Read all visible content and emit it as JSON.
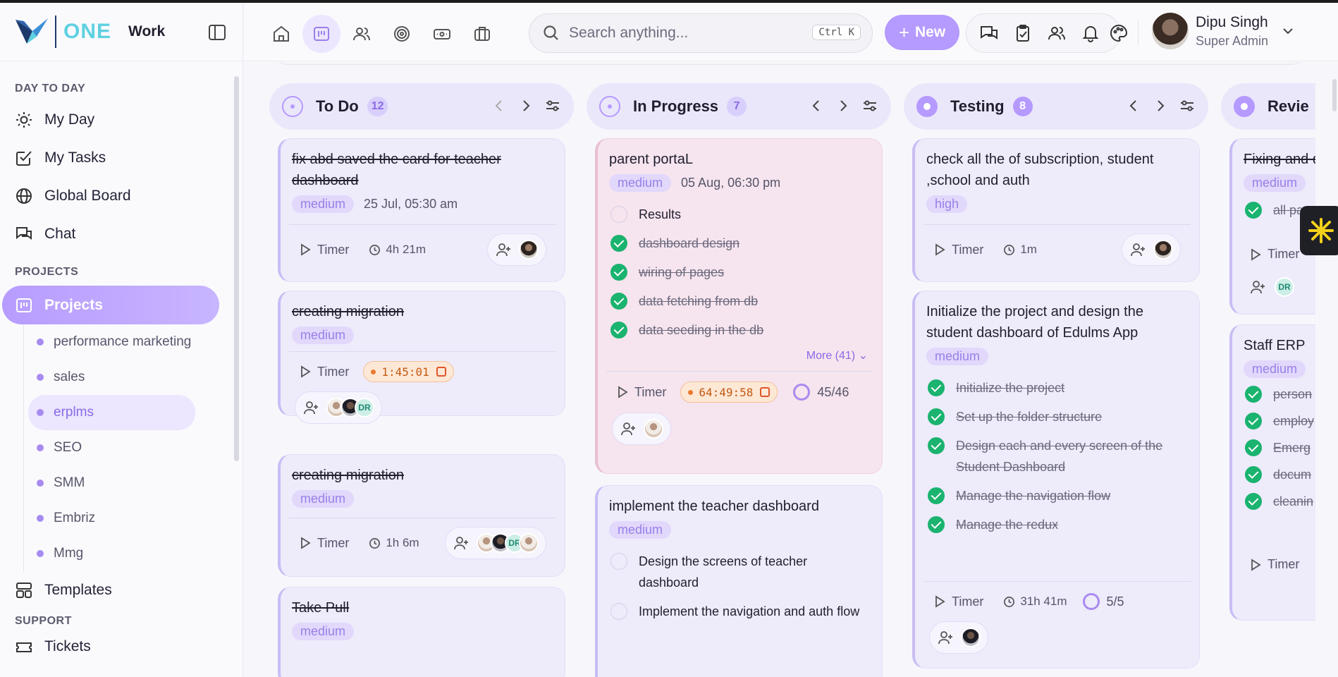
{
  "brand": {
    "one": "ONE",
    "work": "Work"
  },
  "sidebar": {
    "section_day": "DAY TO DAY",
    "day_items": [
      {
        "label": "My Day",
        "icon": "sun-icon"
      },
      {
        "label": "My Tasks",
        "icon": "checkbox-icon"
      },
      {
        "label": "Global Board",
        "icon": "globe-icon"
      },
      {
        "label": "Chat",
        "icon": "chat-icon"
      }
    ],
    "section_projects": "PROJECTS",
    "projects_label": "Projects",
    "sub_items": [
      "performance marketing",
      "sales",
      "erplms",
      "SEO",
      "SMM",
      "Embriz",
      "Mmg"
    ],
    "active_sub": "erplms",
    "templates_label": "Templates",
    "section_support": "SUPPORT",
    "tickets_label": "Tickets"
  },
  "header": {
    "search_placeholder": "Search anything...",
    "search_shortcut": "Ctrl K",
    "new_label": "New",
    "user_name": "Dipu Singh",
    "user_role": "Super Admin"
  },
  "columns": [
    {
      "title": "To Do",
      "count": "12"
    },
    {
      "title": "In Progress",
      "count": "7"
    },
    {
      "title": "Testing",
      "count": "8"
    },
    {
      "title": "Revie",
      "count": ""
    }
  ],
  "todo": {
    "card1": {
      "title": "fix abd saved the card for teacher dashboard",
      "priority": "medium",
      "date": "25 Jul, 05:30 am",
      "timer": "Timer",
      "duration": "4h 21m"
    },
    "card2": {
      "title": "creating migration",
      "priority": "medium",
      "timer": "Timer",
      "running": "1:45:01",
      "dr": "DR"
    },
    "card3": {
      "title": "creating migration",
      "priority": "medium",
      "timer": "Timer",
      "duration": "1h 6m",
      "dr": "DR"
    },
    "card4": {
      "title": "Take Pull",
      "priority": "medium"
    }
  },
  "inprogress": {
    "card1": {
      "title": "parent portaL",
      "priority": "medium",
      "date": "05 Aug, 06:30 pm",
      "checks": [
        {
          "label": "Results",
          "done": false
        },
        {
          "label": "dashboard design",
          "done": true
        },
        {
          "label": "wiring of pages",
          "done": true
        },
        {
          "label": "data fetching from db",
          "done": true
        },
        {
          "label": "data seeding in the db",
          "done": true
        }
      ],
      "more": "More (41)",
      "timer": "Timer",
      "running": "64:49:58",
      "progress": "45/46"
    },
    "card2": {
      "title": "implement the teacher dashboard",
      "priority": "medium",
      "checks": [
        {
          "label": "Design the screens of teacher dashboard",
          "done": false
        },
        {
          "label": "Implement the navigation and auth flow",
          "done": false
        }
      ]
    }
  },
  "testing": {
    "card1": {
      "title": "check all the of subscription, student ,school and auth",
      "priority": "high",
      "timer": "Timer",
      "duration": "1m"
    },
    "card2": {
      "title": "Initialize the project and design the student dashboard of Edulms App",
      "priority": "medium",
      "checks": [
        {
          "label": "Initialize the project",
          "done": true
        },
        {
          "label": "Set up the folder structure",
          "done": true
        },
        {
          "label": "Design each and every screen of the Student Dashboard",
          "done": true
        },
        {
          "label": "Manage the navigation flow",
          "done": true
        },
        {
          "label": "Manage the redux",
          "done": true
        }
      ],
      "timer": "Timer",
      "duration": "31h 41m",
      "progress": "5/5"
    }
  },
  "review": {
    "card1": {
      "title": "Fixing and dashboard",
      "priority": "medium",
      "check": "all pa",
      "timer": "Timer",
      "dr": "DR"
    },
    "card2": {
      "title": "Staff ERP",
      "priority": "medium",
      "checks": [
        "person",
        "employ",
        "Emerg",
        "docum",
        "cleanin"
      ],
      "timer": "Timer"
    }
  }
}
